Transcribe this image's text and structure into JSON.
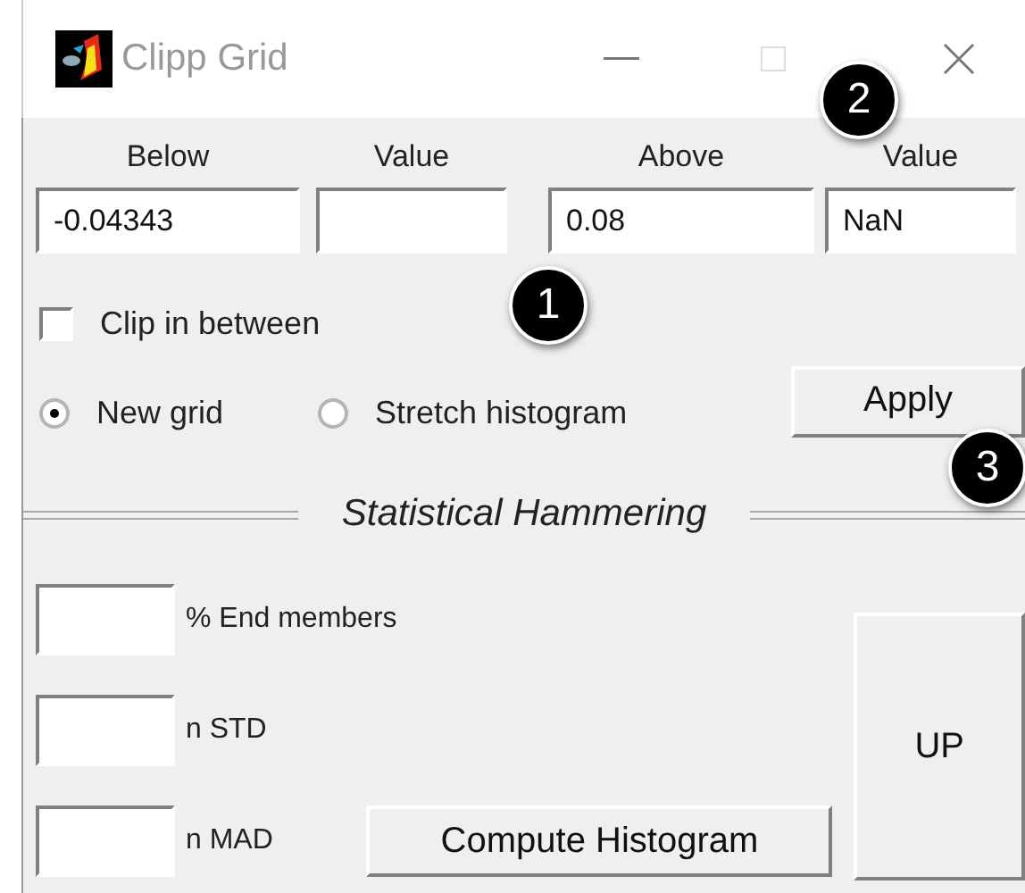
{
  "window": {
    "title": "Clipp Grid"
  },
  "thresholds": [
    {
      "label": "Below",
      "value": "-0.04343"
    },
    {
      "label": "Value"
    },
    {
      "label": "Above",
      "value": "0.08"
    },
    {
      "label": "Value",
      "value": "NaN"
    }
  ],
  "clip_in_between": {
    "label": "Clip in between",
    "checked": false
  },
  "modes": [
    {
      "label": "New grid",
      "selected": true
    },
    {
      "label": "Stretch histogram",
      "selected": false
    }
  ],
  "apply_button": "Apply",
  "section": {
    "title": "Statistical Hammering"
  },
  "stat_fields": [
    {
      "label": "% End members"
    },
    {
      "label": "n STD"
    },
    {
      "label": "n MAD"
    }
  ],
  "compute_button": "Compute Histogram",
  "up_button": "UP",
  "callouts": [
    "1",
    "2",
    "3"
  ]
}
